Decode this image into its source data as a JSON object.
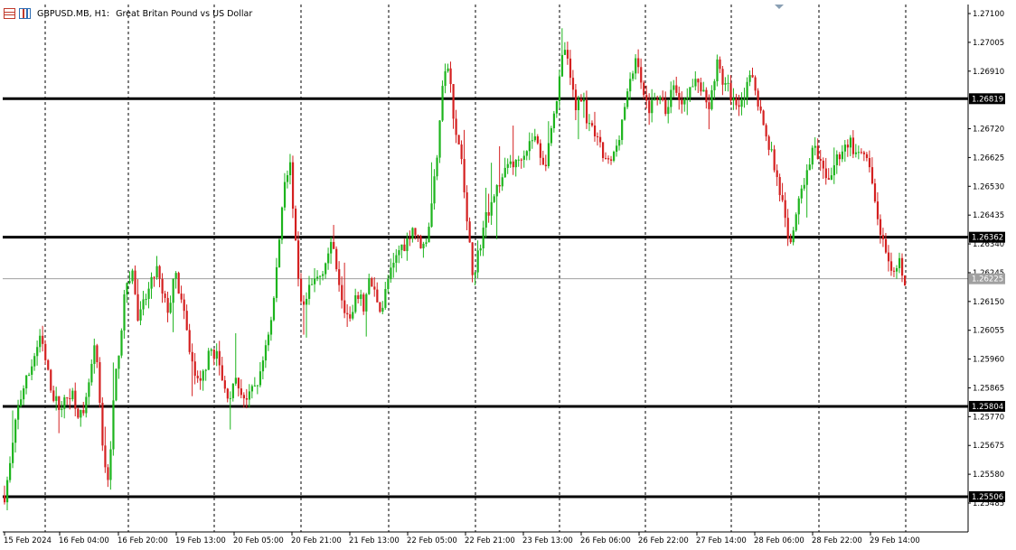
{
  "header": {
    "symbol": "GBPUSD.MB, H1:",
    "description": "Great Britan Pound vs US Dollar"
  },
  "price_axis": {
    "ticks": [
      "1.27100",
      "1.27005",
      "1.26910",
      "1.26720",
      "1.26625",
      "1.26530",
      "1.26435",
      "1.26340",
      "1.26245",
      "1.26150",
      "1.26055",
      "1.25960",
      "1.25865",
      "1.25770",
      "1.25675",
      "1.25580",
      "1.25485"
    ]
  },
  "time_axis": {
    "labels": [
      "15 Feb 2024",
      "16 Feb 04:00",
      "16 Feb 20:00",
      "19 Feb 13:00",
      "20 Feb 05:00",
      "20 Feb 21:00",
      "21 Feb 13:00",
      "22 Feb 05:00",
      "22 Feb 21:00",
      "23 Feb 13:00",
      "26 Feb 06:00",
      "26 Feb 22:00",
      "27 Feb 14:00",
      "28 Feb 06:00",
      "28 Feb 22:00",
      "29 Feb 14:00"
    ]
  },
  "levels": [
    {
      "label": "1.26819",
      "price": 1.26819
    },
    {
      "label": "1.26362",
      "price": 1.26362
    },
    {
      "label": "1.25804",
      "price": 1.25804
    },
    {
      "label": "1.25506",
      "price": 1.25506
    }
  ],
  "current_price": {
    "label": "1.26225",
    "price": 1.26225
  },
  "colors": {
    "bull": "#1db41d",
    "bear": "#d42020",
    "grid": "#000000",
    "level": "#000000",
    "current_line": "#a0a0a0"
  },
  "chart_data": {
    "type": "candlestick",
    "title": "GBPUSD.MB, H1: Great Britan Pound vs US Dollar",
    "ylim": [
      1.2543,
      1.2712
    ],
    "path": [
      1.2551,
      1.2562,
      1.2578,
      1.2586,
      1.2591,
      1.2598,
      1.2603,
      1.2592,
      1.2584,
      1.258,
      1.2582,
      1.2586,
      1.2579,
      1.2576,
      1.259,
      1.2601,
      1.2568,
      1.2555,
      1.2585,
      1.2603,
      1.2621,
      1.2625,
      1.2608,
      1.2615,
      1.262,
      1.2626,
      1.2616,
      1.2612,
      1.2624,
      1.2616,
      1.2604,
      1.2593,
      1.2586,
      1.2594,
      1.2599,
      1.2597,
      1.2586,
      1.2584,
      1.2588,
      1.2585,
      1.2582,
      1.2587,
      1.259,
      1.2602,
      1.261,
      1.2632,
      1.2656,
      1.266,
      1.2628,
      1.2612,
      1.2618,
      1.2622,
      1.2624,
      1.263,
      1.2634,
      1.2622,
      1.2612,
      1.2608,
      1.2618,
      1.2613,
      1.2622,
      1.2617,
      1.2612,
      1.2622,
      1.2627,
      1.2633,
      1.2634,
      1.264,
      1.2635,
      1.2633,
      1.2643,
      1.2662,
      1.2688,
      1.2693,
      1.267,
      1.2665,
      1.264,
      1.2624,
      1.2632,
      1.2642,
      1.2648,
      1.2653,
      1.2656,
      1.2662,
      1.266,
      1.2664,
      1.2666,
      1.267,
      1.2664,
      1.266,
      1.2676,
      1.2684,
      1.27,
      1.2688,
      1.2679,
      1.2684,
      1.2672,
      1.267,
      1.2665,
      1.266,
      1.2662,
      1.267,
      1.268,
      1.2688,
      1.2697,
      1.2682,
      1.2679,
      1.2684,
      1.268,
      1.2678,
      1.2688,
      1.268,
      1.2684,
      1.2686,
      1.2688,
      1.2683,
      1.268,
      1.2694,
      1.2688,
      1.2685,
      1.268,
      1.2682,
      1.2685,
      1.269,
      1.268,
      1.267,
      1.2665,
      1.2655,
      1.2646,
      1.263,
      1.2644,
      1.265,
      1.266,
      1.2666,
      1.266,
      1.2655,
      1.2658,
      1.2663,
      1.2666,
      1.2668,
      1.2662,
      1.2664,
      1.266,
      1.2648,
      1.2638,
      1.2628,
      1.2622,
      1.2628,
      1.2622
    ]
  }
}
